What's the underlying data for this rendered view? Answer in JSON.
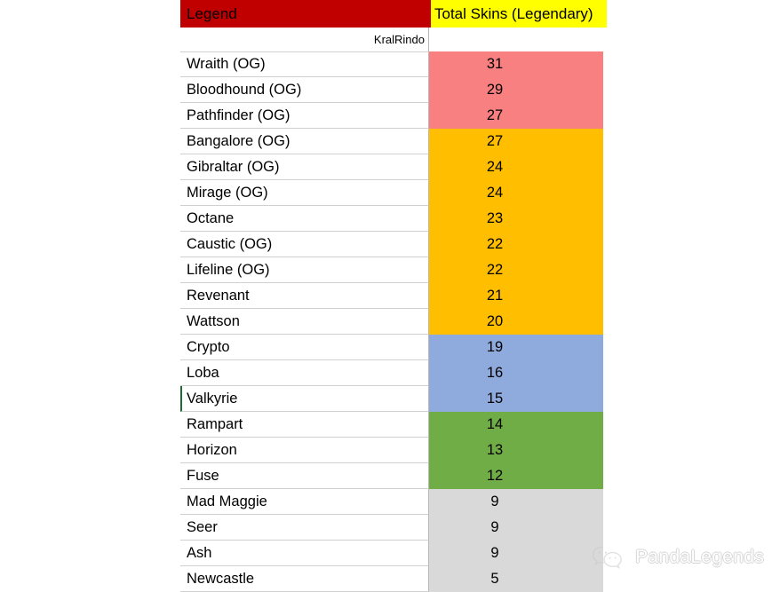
{
  "sheet": {
    "headers": {
      "legend": "Legend",
      "total": "Total Skins (Legendary)"
    },
    "subheader": {
      "author": "KralRindo"
    },
    "colors": {
      "header_legend_bg": "#C00000",
      "header_total_bg": "#FFFF00",
      "band_red": "#F98080",
      "band_orange": "#FFBF00",
      "band_blue": "#8FAADC",
      "band_green": "#70AD47",
      "band_gray": "#D9D9D9",
      "active_cell_border": "#1E6B33",
      "grid_line": "#D0D0D0"
    },
    "rows": [
      {
        "legend": "Wraith (OG)",
        "value": "31",
        "band": "red"
      },
      {
        "legend": "Bloodhound (OG)",
        "value": "29",
        "band": "red"
      },
      {
        "legend": "Pathfinder (OG)",
        "value": "27",
        "band": "red"
      },
      {
        "legend": "Bangalore (OG)",
        "value": "27",
        "band": "orange"
      },
      {
        "legend": "Gibraltar (OG)",
        "value": "24",
        "band": "orange"
      },
      {
        "legend": "Mirage (OG)",
        "value": "24",
        "band": "orange"
      },
      {
        "legend": "Octane",
        "value": "23",
        "band": "orange"
      },
      {
        "legend": "Caustic (OG)",
        "value": "22",
        "band": "orange"
      },
      {
        "legend": "Lifeline (OG)",
        "value": "22",
        "band": "orange"
      },
      {
        "legend": "Revenant",
        "value": "21",
        "band": "orange"
      },
      {
        "legend": "Wattson",
        "value": "20",
        "band": "orange"
      },
      {
        "legend": "Crypto",
        "value": "19",
        "band": "blue"
      },
      {
        "legend": "Loba",
        "value": "16",
        "band": "blue"
      },
      {
        "legend": "Valkyrie",
        "value": "15",
        "band": "blue",
        "active": true
      },
      {
        "legend": "Rampart",
        "value": "14",
        "band": "green"
      },
      {
        "legend": "Horizon",
        "value": "13",
        "band": "green"
      },
      {
        "legend": "Fuse",
        "value": "12",
        "band": "green"
      },
      {
        "legend": "Mad Maggie",
        "value": "9",
        "band": "gray"
      },
      {
        "legend": "Seer",
        "value": "9",
        "band": "gray"
      },
      {
        "legend": "Ash",
        "value": "9",
        "band": "gray"
      },
      {
        "legend": "Newcastle",
        "value": "5",
        "band": "gray"
      }
    ]
  },
  "watermark": {
    "label": "PandaLegends",
    "icon": "wechat-icon"
  },
  "chart_data": {
    "type": "table",
    "title": "Total Skins (Legendary)",
    "columns": [
      "Legend",
      "Total Skins (Legendary)"
    ],
    "categories": [
      "Wraith (OG)",
      "Bloodhound (OG)",
      "Pathfinder (OG)",
      "Bangalore (OG)",
      "Gibraltar (OG)",
      "Mirage (OG)",
      "Octane",
      "Caustic (OG)",
      "Lifeline (OG)",
      "Revenant",
      "Wattson",
      "Crypto",
      "Loba",
      "Valkyrie",
      "Rampart",
      "Horizon",
      "Fuse",
      "Mad Maggie",
      "Seer",
      "Ash",
      "Newcastle"
    ],
    "values": [
      31,
      29,
      27,
      27,
      24,
      24,
      23,
      22,
      22,
      21,
      20,
      19,
      16,
      15,
      14,
      13,
      12,
      9,
      9,
      9,
      5
    ],
    "ylabel": "Total Skins (Legendary)",
    "xlabel": "Legend",
    "ylim": [
      0,
      31
    ],
    "grid": false,
    "legend": "none",
    "annotations": [
      "KralRindo"
    ]
  }
}
